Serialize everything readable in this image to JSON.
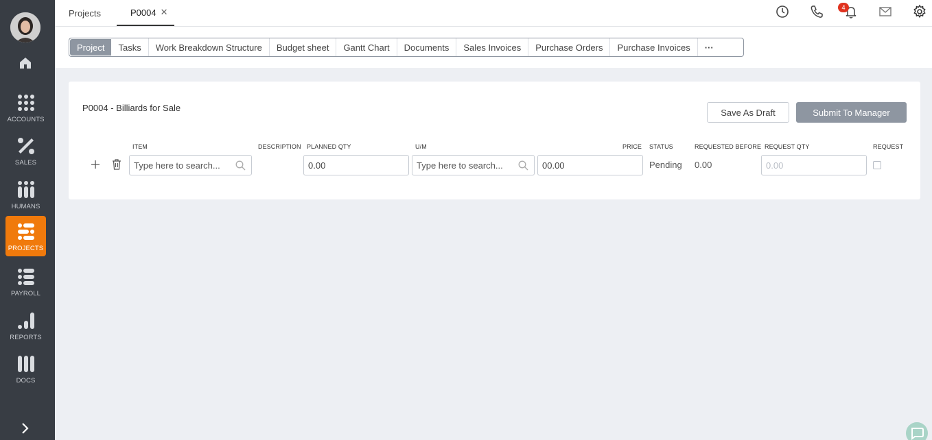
{
  "sidebar": {
    "items": [
      {
        "label": "ACCOUNTS",
        "icon": "grid-dots-icon"
      },
      {
        "label": "SALES",
        "icon": "percent-icon"
      },
      {
        "label": "HUMANS",
        "icon": "people-icon"
      },
      {
        "label": "PROJECTS",
        "icon": "projects-icon"
      },
      {
        "label": "PAYROLL",
        "icon": "list-icon"
      },
      {
        "label": "REPORTS",
        "icon": "bar-chart-icon"
      },
      {
        "label": "DOCS",
        "icon": "docs-icon"
      }
    ],
    "active": "PROJECTS",
    "accent": "#f07a0c"
  },
  "topbar": {
    "tabs": [
      {
        "label": "Projects"
      },
      {
        "label": "P0004"
      }
    ],
    "notification_count": "4"
  },
  "tabstrip": {
    "tabs": [
      "Project",
      "Tasks",
      "Work Breakdown Structure",
      "Budget sheet",
      "Gantt Chart",
      "Documents",
      "Sales Invoices",
      "Purchase Orders",
      "Purchase Invoices"
    ],
    "more": "···"
  },
  "card": {
    "title": "P0004 - Billiards for Sale",
    "save_draft": "Save As Draft",
    "submit": "Submit To Manager"
  },
  "table": {
    "headers": {
      "item": "ITEM",
      "description": "DESCRIPTION",
      "planned_qty": "PLANNED QTY",
      "um": "U/M",
      "price": "PRICE",
      "status": "STATUS",
      "requested_before": "REQUESTED BEFORE",
      "request_qty": "REQUEST QTY",
      "request": "REQUEST"
    },
    "row": {
      "item_placeholder": "Type here to search...",
      "planned_qty": "0.00",
      "um_placeholder": "Type here to search...",
      "price": "00.00",
      "status": "Pending",
      "requested_before": "0.00",
      "request_qty_placeholder": "0.00"
    }
  }
}
